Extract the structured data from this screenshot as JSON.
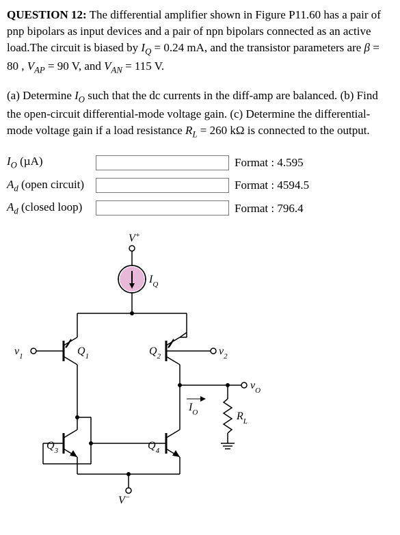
{
  "question": {
    "number_label": "QUESTION 12:",
    "text_part1": " The differential amplifier shown in Figure P11.60 has a pair of pnp bipolars as input devices and a pair of npn bipolars connected as an active load.The circuit is biased by ",
    "iq_symbol": "I",
    "iq_sub": "Q",
    "iq_value": " = 0.24 mA, and the transistor parameters are ",
    "beta_symbol": "β",
    "beta_value": " = 80 , ",
    "vap_symbol": "V",
    "vap_sub": "AP",
    "vap_value": " = 90 V, and ",
    "van_symbol": "V",
    "van_sub": "AN",
    "van_value": " = 115 V."
  },
  "parts": {
    "a_prefix": "(a) Determine ",
    "a_io_symbol": "I",
    "a_io_sub": "O",
    "a_suffix": " such that the dc currents in the diff-amp are balanced. ",
    "b_text": "(b) Find the open-circuit differential-mode voltage gain. (c) Determine the differential-mode voltage gain if a load resistance ",
    "rl_symbol": "R",
    "rl_sub": "L",
    "rl_value": " = 260 kΩ is connected to the output."
  },
  "answers": {
    "row1": {
      "symbol": "I",
      "sub": "O",
      "unit": " (µA)",
      "format": "Format : 4.595"
    },
    "row2": {
      "symbol": "A",
      "sub": "d",
      "note": " (open circuit)",
      "format": "Format : 4594.5"
    },
    "row3": {
      "symbol": "A",
      "sub": "d",
      "note": " (closed loop)",
      "format": "Format : 796.4"
    }
  },
  "circuit": {
    "v_plus": "V⁺",
    "v_minus": "V⁻",
    "iq": "IQ",
    "io": "IO",
    "v1": "v₁",
    "v2": "v₂",
    "vo": "vO",
    "q1": "Q₁",
    "q2": "Q₂",
    "q3": "Q₃",
    "q4": "Q₄",
    "rl": "RL"
  }
}
